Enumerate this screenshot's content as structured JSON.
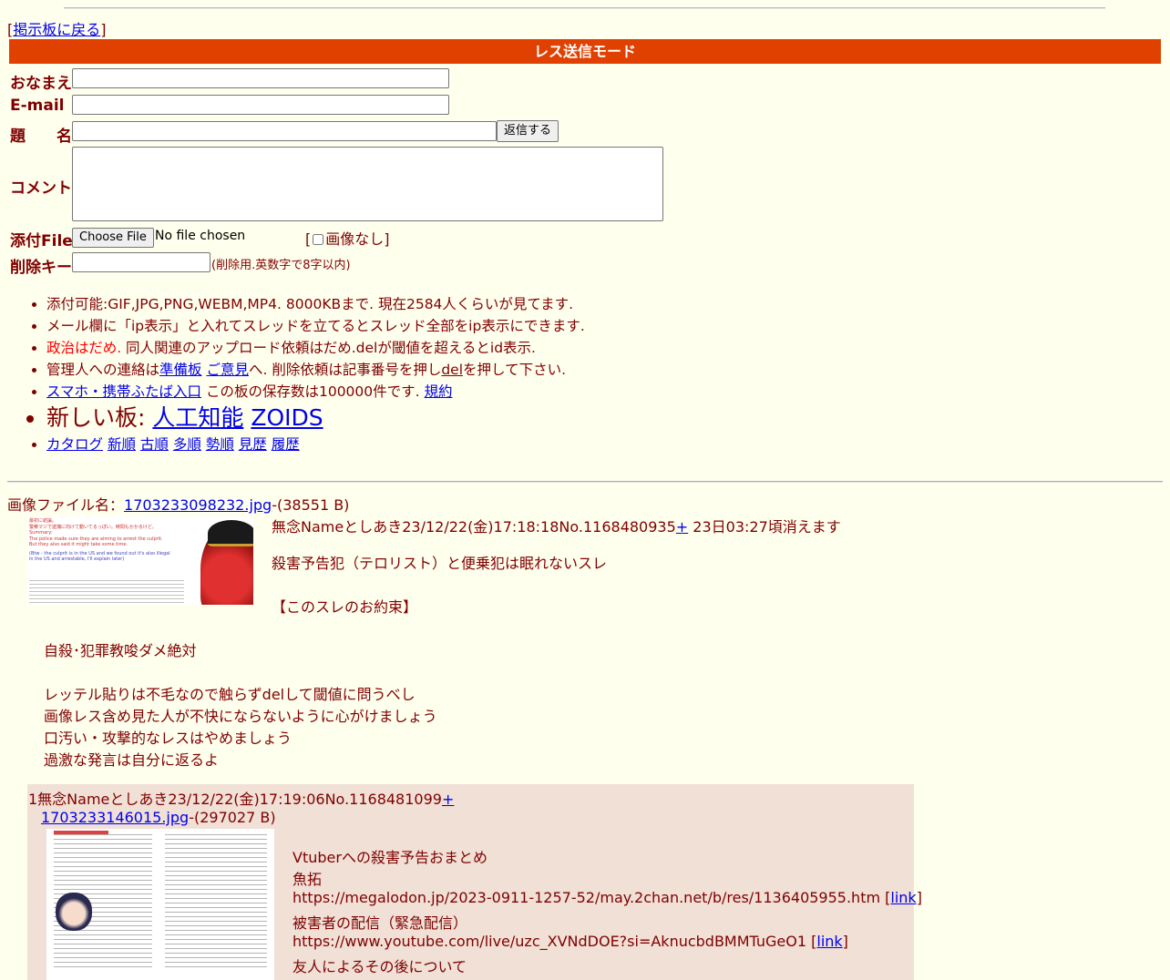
{
  "nav": {
    "back_open": "[",
    "back_label": "掲示板に戻る",
    "back_close": "]"
  },
  "form": {
    "mode_title": "レス送信モード",
    "name_label": "おなまえ",
    "email_label": "E-mail",
    "subject_label": "題　　名",
    "submit_label": "返信する",
    "comment_label": "コメント",
    "file_label": "添付File",
    "file_button": "Choose File",
    "file_status": "No file chosen",
    "noimg_open": "[",
    "noimg_label": "画像なし",
    "noimg_close": "]",
    "delkey_label": "削除キー",
    "delkey_note": "(削除用.英数字で8字以内)"
  },
  "notes": {
    "n1": "添付可能:GIF,JPG,PNG,WEBM,MP4. 8000KBまで. 現在2584人くらいが見てます.",
    "n2": "メール欄に「ip表示」と入れてスレッドを立てるとスレッド全部をip表示にできます.",
    "n3_red": "政治はだめ.",
    "n3_rest": " 同人関連のアップロード依頼はだめ.delが閾値を超えるとid表示.",
    "n4_a": "管理人への連絡は",
    "n4_link1": "準備板",
    "n4_sp": " ",
    "n4_link2": "ご意見",
    "n4_b": "へ. 削除依頼は記事番号を押し",
    "n4_del": "del",
    "n4_c": "を押して下さい.",
    "n5_link": "スマホ・携帯ふたば入口",
    "n5_mid": " この板の保存数は100000件です. ",
    "n5_rule": "規約",
    "n6_prefix": "新しい板: ",
    "n6_link1": "人工知能",
    "n6_link2": "ZOIDS",
    "cat": [
      "カタログ",
      "新順",
      "古順",
      "多順",
      "勢順",
      "見歴",
      "履歴"
    ]
  },
  "op": {
    "file_prefix": "画像ファイル名：",
    "file_name": "1703233098232.jpg",
    "file_size": "-(38551 B)",
    "header": "無念Nameとしあき23/12/22(金)17:18:18No.1168480935",
    "plus": "+",
    "expire": " 23日03:27頃消えます",
    "title_line": "殺害予告犯（テロリスト）と便乗犯は眠れないスレ",
    "rules_head": "【このスレのお約束】",
    "rule1": "自殺･犯罪教唆ダメ絶対",
    "rule2": "レッテル貼りは不毛なので触らずdelして閾値に問うべし",
    "rule3": "画像レス含め見た人が不快にならないように心がけましょう",
    "rule4": "口汚い・攻撃的なレスはやめましょう",
    "rule5": "過激な発言は自分に返るよ",
    "thumb_text1": "最初に結論。",
    "thumb_text2": "警察マジで逮捕に向けて動いてるっぽい。時間もかかるけど。",
    "thumb_text3": "Summary:",
    "thumb_text4": "The police made sure they are aiming to arrest the culprit.",
    "thumb_text5": "But they also said it might take some time.",
    "thumb_text6": "(Btw - the culprit is in the US and we found out it's also illegal",
    "thumb_text7": "in the US and arrestable, I'll explain later)"
  },
  "reply1": {
    "header": "1無念Nameとしあき23/12/22(金)17:19:06No.1168481099",
    "plus": "+",
    "file_name": "1703233146015.jpg",
    "file_size": "-(297027 B)",
    "l1": "Vtuberへの殺害予告おまとめ",
    "l2": "魚拓",
    "l3_url": "https://megalodon.jp/2023-0911-1257-52/may.2chan.net/b/res/1136405955.htm",
    "l3_open": " [",
    "l3_link": "link",
    "l3_close": "]",
    "l4": "被害者の配信（緊急配信）",
    "l5_url": "https://www.youtube.com/live/uzc_XVNdDOE?si=AknucbdBMMTuGeO1",
    "l5_open": " [",
    "l5_link": "link",
    "l5_close": "]",
    "l6": "友人によるその後について"
  },
  "colors": {
    "background": "#ffffee",
    "text": "#800000",
    "mode_bar": "#e04000",
    "reply_bg": "#f0e0d6",
    "link": "#0000ee",
    "alert": "#ff0000"
  }
}
